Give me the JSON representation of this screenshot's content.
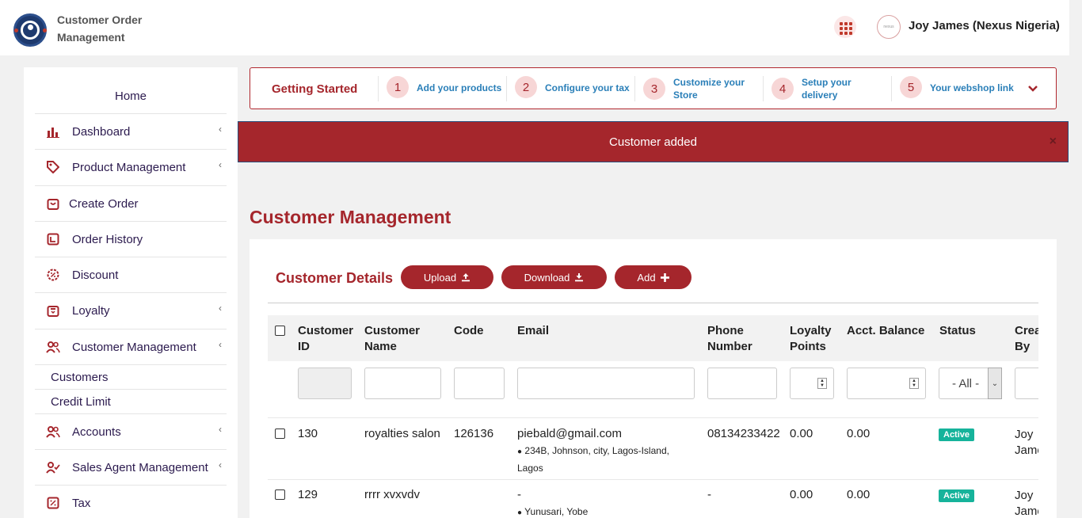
{
  "header": {
    "app_title": "Customer Order Management",
    "user_name": "Joy James (Nexus Nigeria)",
    "avatar_text": "nexus"
  },
  "sidebar": {
    "home": "Home",
    "items": [
      {
        "label": "Dashboard",
        "icon": "bar-chart-icon",
        "chevron": true
      },
      {
        "label": "Product Management",
        "icon": "tag-icon",
        "chevron": true
      },
      {
        "label": "Create Order",
        "icon": "shopping-bag-icon",
        "chevron": false
      },
      {
        "label": "Order History",
        "icon": "history-icon",
        "chevron": false
      },
      {
        "label": "Discount",
        "icon": "discount-icon",
        "chevron": false
      },
      {
        "label": "Loyalty",
        "icon": "gift-icon",
        "chevron": true
      },
      {
        "label": "Customer Management",
        "icon": "users-icon",
        "chevron": true
      },
      {
        "label": "Accounts",
        "icon": "users-icon",
        "chevron": true
      },
      {
        "label": "Sales Agent Management",
        "icon": "user-check-icon",
        "chevron": true
      },
      {
        "label": "Tax",
        "icon": "percent-icon",
        "chevron": false
      }
    ],
    "sub_items": [
      "Customers",
      "Credit Limit"
    ]
  },
  "getting_started": {
    "title": "Getting Started",
    "steps": [
      {
        "num": "1",
        "label": "Add your products"
      },
      {
        "num": "2",
        "label": "Configure your tax"
      },
      {
        "num": "3",
        "label": "Customize your Store"
      },
      {
        "num": "4",
        "label": "Setup your delivery"
      },
      {
        "num": "5",
        "label": "Your webshop link"
      }
    ]
  },
  "alert": {
    "message": "Customer added",
    "close": "×"
  },
  "page": {
    "title": "Customer Management"
  },
  "card": {
    "title": "Customer Details",
    "buttons": {
      "upload": "Upload",
      "download": "Download",
      "add": "Add"
    }
  },
  "table": {
    "columns": [
      "Customer ID",
      "Customer Name",
      "Code",
      "Email",
      "Phone Number",
      "Loyalty Points",
      "Acct. Balance",
      "Status",
      "Created By"
    ],
    "status_filter": "- All -",
    "rows": [
      {
        "id": "130",
        "name": "royalties salon",
        "code": "126136",
        "email": "piebald@gmail.com",
        "address": "234B, Johnson, city, Lagos-Island, Lagos",
        "phone": "08134233422",
        "loyalty": "0.00",
        "balance": "0.00",
        "status": "Active",
        "created_by": "Joy James"
      },
      {
        "id": "129",
        "name": "rrrr xvxvdv",
        "code": "",
        "email": "-",
        "address": "Yunusari, Yobe",
        "phone": "-",
        "loyalty": "0.00",
        "balance": "0.00",
        "status": "Active",
        "created_by": "Joy James"
      }
    ]
  },
  "colors": {
    "brand": "#a5262c",
    "link": "#2a7fb8",
    "active": "#16b39b"
  }
}
